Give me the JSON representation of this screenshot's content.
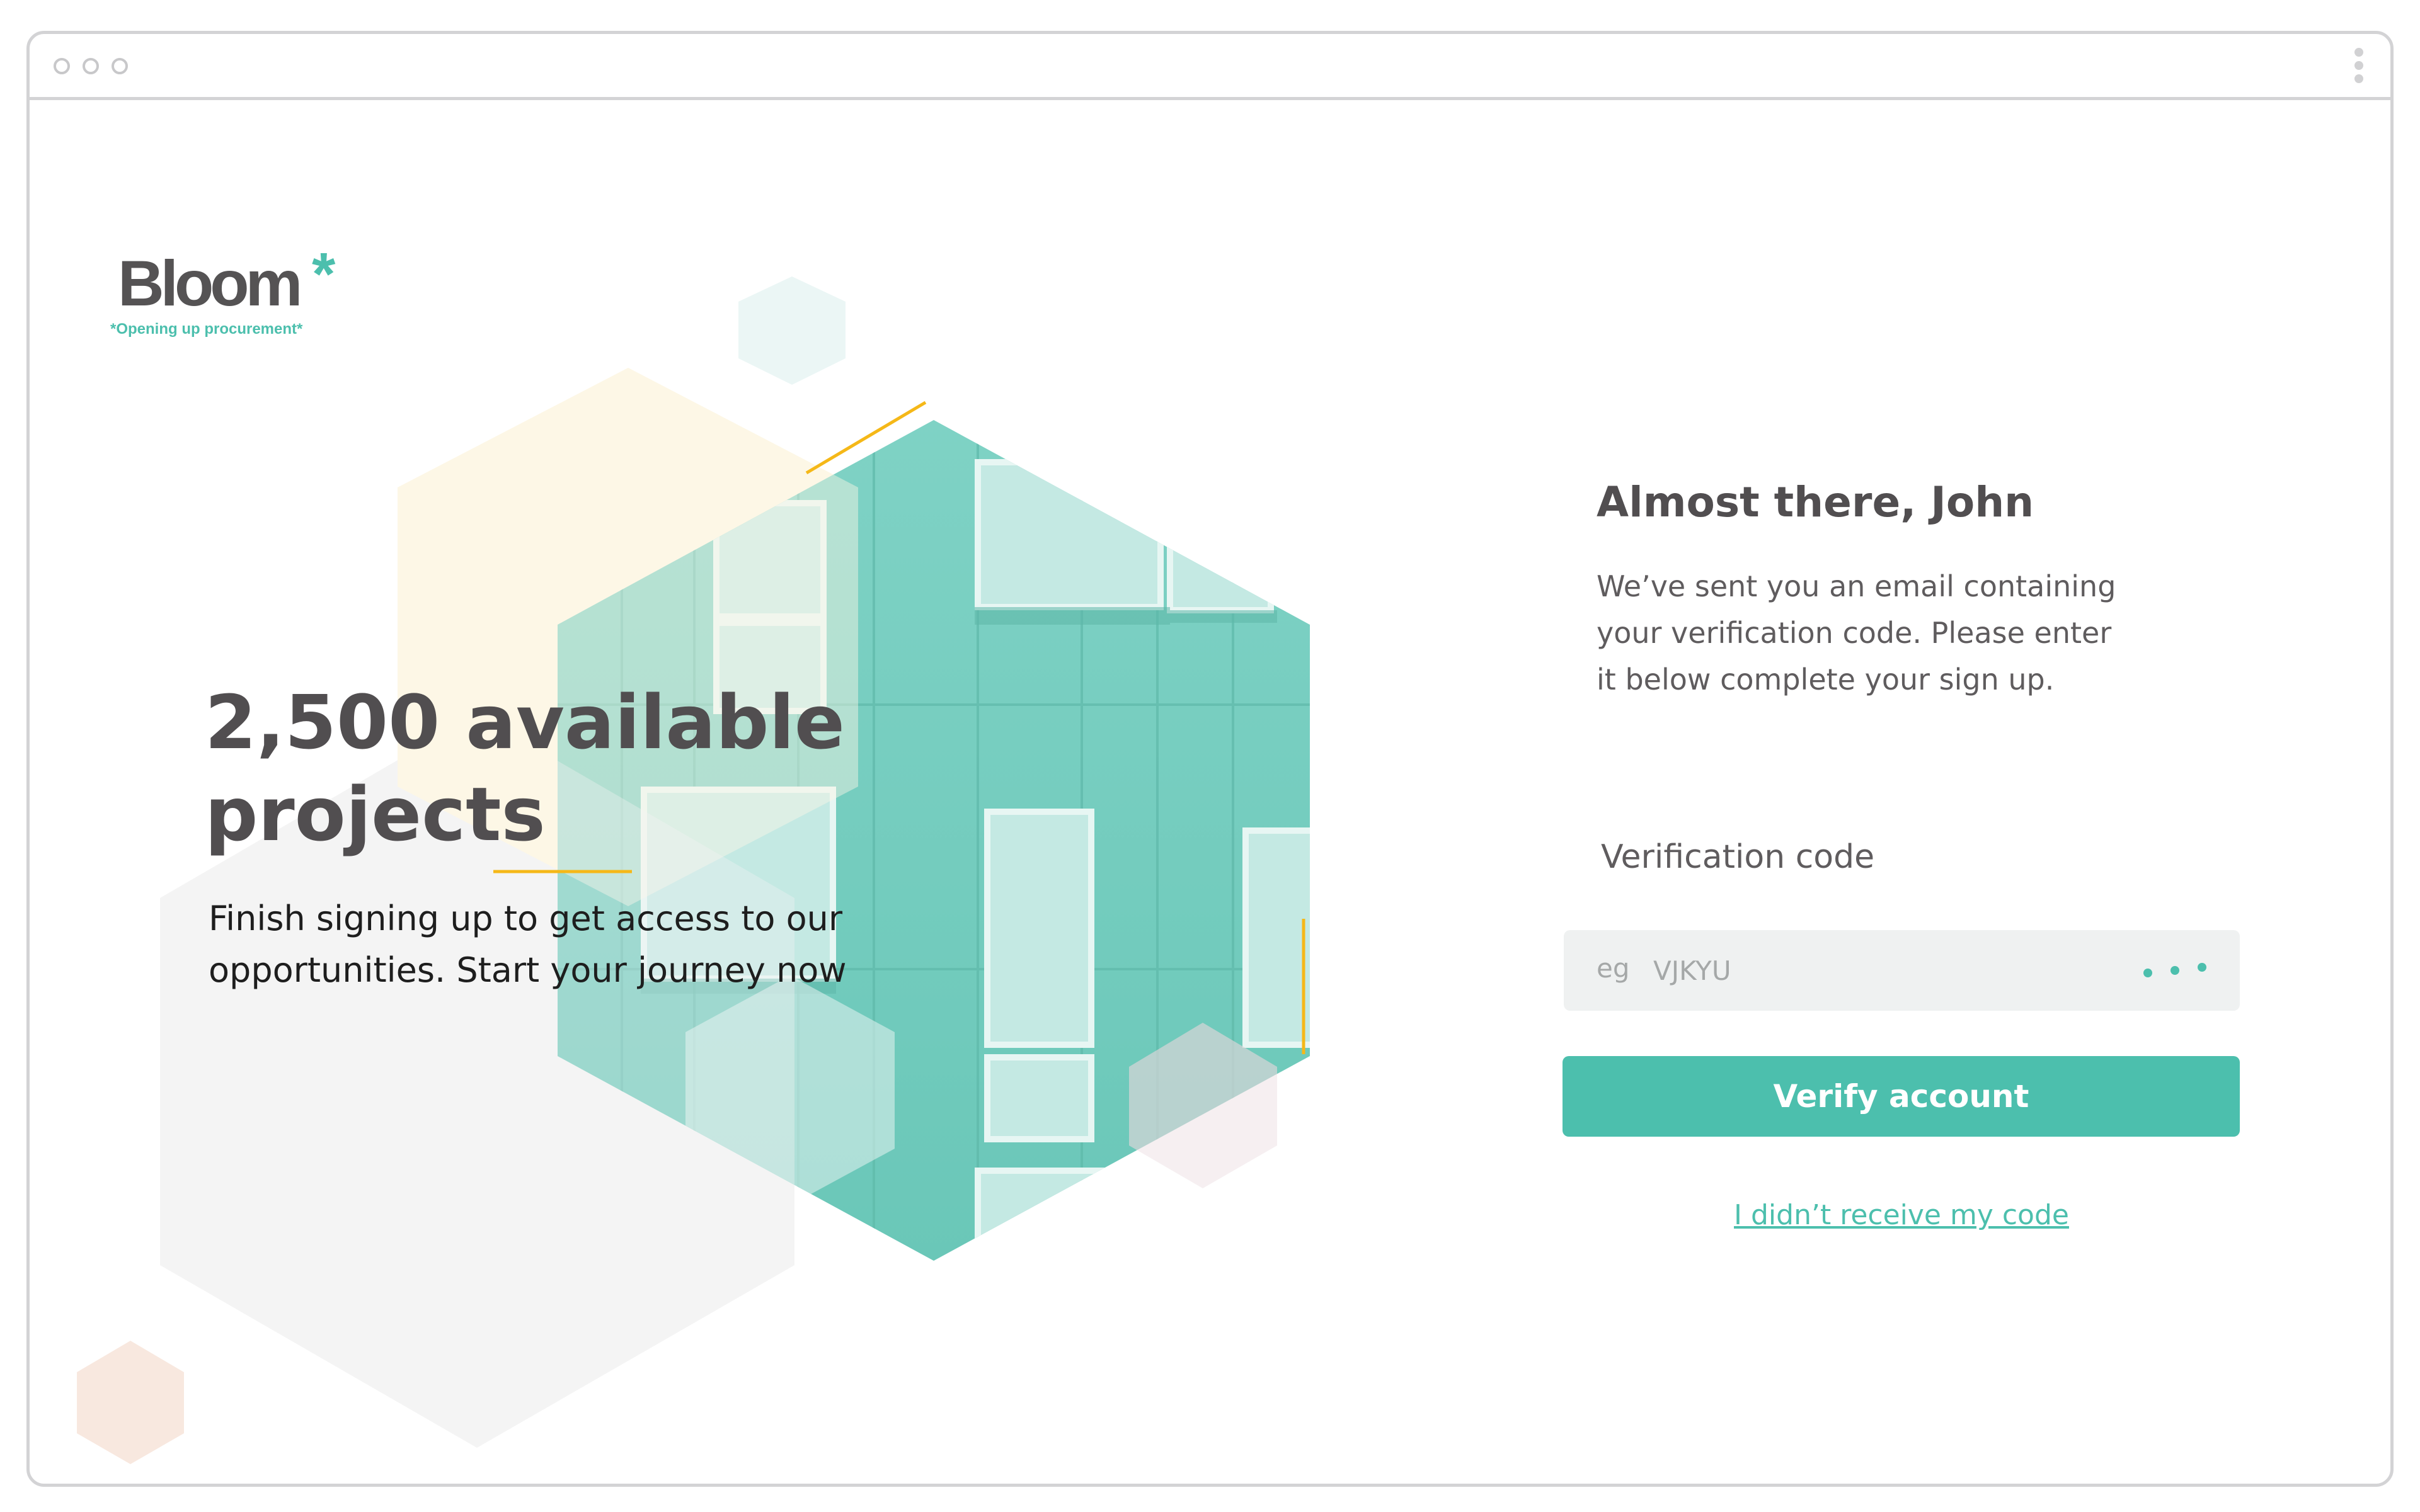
{
  "window": {
    "controls": [
      "circle",
      "circle",
      "circle"
    ],
    "menu_icon": "kebab-vertical-icon"
  },
  "brand": {
    "name": "Bloom",
    "mark": "*",
    "tagline": "*Opening up procurement*",
    "accent_color": "#4cbfad",
    "text_color": "#555354"
  },
  "hero": {
    "headline_line1": "2,500 available",
    "headline_line2": "projects",
    "subtext_line1": "Finish signing up to get access to our",
    "subtext_line2": "opportunities. Start your journey now"
  },
  "panel": {
    "title": "Almost there, John",
    "body_line1": "We’ve sent you an email containing",
    "body_line2": "your verification code. Please enter",
    "body_line3": "it below complete your sign up.",
    "field_label": "Verification code",
    "field_prefix": "eg",
    "field_placeholder": "VJKYU",
    "field_value": "",
    "field_icon": "dots-icon",
    "verify_label": "Verify account",
    "resend_label": "I didn’t receive my code"
  },
  "colors": {
    "accent": "#4cbfad",
    "input_bg": "#eff1f1",
    "heading": "#514e50",
    "decor_yellow": "#f5b818"
  }
}
